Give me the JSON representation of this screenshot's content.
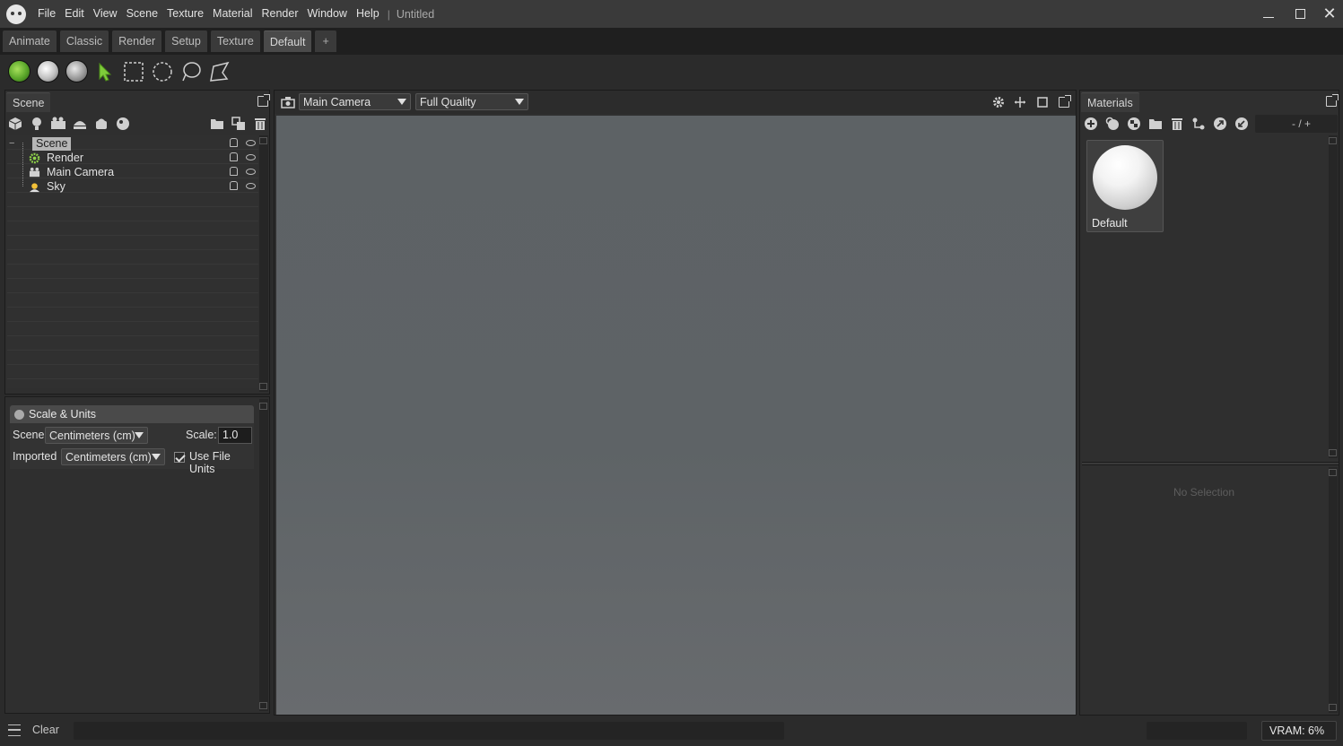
{
  "menu": {
    "items": [
      "File",
      "Edit",
      "View",
      "Scene",
      "Texture",
      "Material",
      "Render",
      "Window",
      "Help"
    ],
    "separator": "|",
    "document_title": "Untitled"
  },
  "layout_tabs": {
    "items": [
      "Animate",
      "Classic",
      "Render",
      "Setup",
      "Texture",
      "Default"
    ],
    "active": "Default",
    "add_label": "+"
  },
  "scene_panel": {
    "tab_label": "Scene",
    "tree": [
      {
        "label": "Scene",
        "icon": "scene-root-icon",
        "selected": true
      },
      {
        "label": "Render",
        "icon": "render-gear-icon"
      },
      {
        "label": "Main Camera",
        "icon": "camera-icon"
      },
      {
        "label": "Sky",
        "icon": "sky-sun-icon"
      }
    ]
  },
  "scale_units": {
    "header": "Scale & Units",
    "scene_label": "Scene",
    "scene_unit": "Centimeters (cm)",
    "scale_label": "Scale:",
    "scale_value": "1.0",
    "imported_label": "Imported",
    "imported_unit": "Centimeters (cm)",
    "use_file_units_label": "Use File Units",
    "use_file_units_checked": true
  },
  "viewport": {
    "camera_select": "Main Camera",
    "quality_select": "Full Quality",
    "status_color": "#5fbf2a"
  },
  "materials_panel": {
    "tab_label": "Materials",
    "search_text": "- / +",
    "items": [
      {
        "label": "Default"
      }
    ],
    "no_selection_text": "No Selection"
  },
  "statusbar": {
    "clear_label": "Clear",
    "vram_text": "VRAM: 6%"
  },
  "colors": {
    "accent_green": "#5fbf2a",
    "background": "#2b2b2b",
    "viewport_bg": "#5e6366"
  }
}
